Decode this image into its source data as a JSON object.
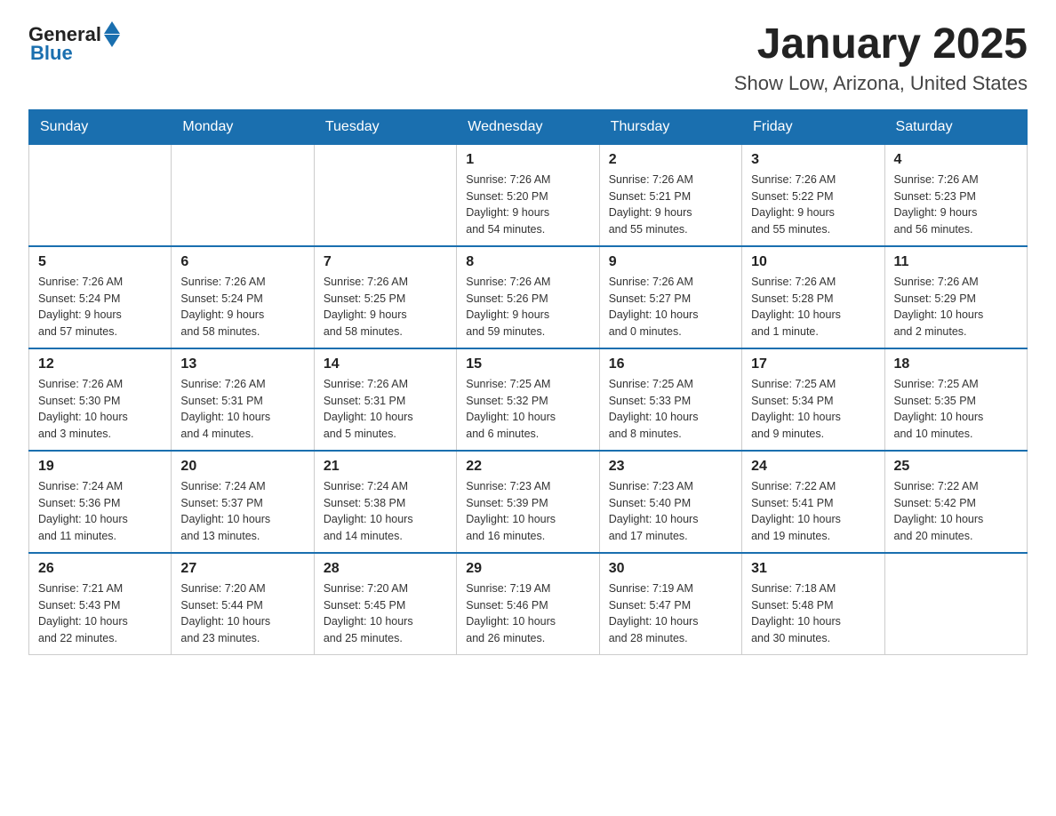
{
  "header": {
    "logo_general": "General",
    "logo_blue": "Blue",
    "month_title": "January 2025",
    "location": "Show Low, Arizona, United States"
  },
  "days_of_week": [
    "Sunday",
    "Monday",
    "Tuesday",
    "Wednesday",
    "Thursday",
    "Friday",
    "Saturday"
  ],
  "weeks": [
    [
      {
        "day": "",
        "info": ""
      },
      {
        "day": "",
        "info": ""
      },
      {
        "day": "",
        "info": ""
      },
      {
        "day": "1",
        "info": "Sunrise: 7:26 AM\nSunset: 5:20 PM\nDaylight: 9 hours\nand 54 minutes."
      },
      {
        "day": "2",
        "info": "Sunrise: 7:26 AM\nSunset: 5:21 PM\nDaylight: 9 hours\nand 55 minutes."
      },
      {
        "day": "3",
        "info": "Sunrise: 7:26 AM\nSunset: 5:22 PM\nDaylight: 9 hours\nand 55 minutes."
      },
      {
        "day": "4",
        "info": "Sunrise: 7:26 AM\nSunset: 5:23 PM\nDaylight: 9 hours\nand 56 minutes."
      }
    ],
    [
      {
        "day": "5",
        "info": "Sunrise: 7:26 AM\nSunset: 5:24 PM\nDaylight: 9 hours\nand 57 minutes."
      },
      {
        "day": "6",
        "info": "Sunrise: 7:26 AM\nSunset: 5:24 PM\nDaylight: 9 hours\nand 58 minutes."
      },
      {
        "day": "7",
        "info": "Sunrise: 7:26 AM\nSunset: 5:25 PM\nDaylight: 9 hours\nand 58 minutes."
      },
      {
        "day": "8",
        "info": "Sunrise: 7:26 AM\nSunset: 5:26 PM\nDaylight: 9 hours\nand 59 minutes."
      },
      {
        "day": "9",
        "info": "Sunrise: 7:26 AM\nSunset: 5:27 PM\nDaylight: 10 hours\nand 0 minutes."
      },
      {
        "day": "10",
        "info": "Sunrise: 7:26 AM\nSunset: 5:28 PM\nDaylight: 10 hours\nand 1 minute."
      },
      {
        "day": "11",
        "info": "Sunrise: 7:26 AM\nSunset: 5:29 PM\nDaylight: 10 hours\nand 2 minutes."
      }
    ],
    [
      {
        "day": "12",
        "info": "Sunrise: 7:26 AM\nSunset: 5:30 PM\nDaylight: 10 hours\nand 3 minutes."
      },
      {
        "day": "13",
        "info": "Sunrise: 7:26 AM\nSunset: 5:31 PM\nDaylight: 10 hours\nand 4 minutes."
      },
      {
        "day": "14",
        "info": "Sunrise: 7:26 AM\nSunset: 5:31 PM\nDaylight: 10 hours\nand 5 minutes."
      },
      {
        "day": "15",
        "info": "Sunrise: 7:25 AM\nSunset: 5:32 PM\nDaylight: 10 hours\nand 6 minutes."
      },
      {
        "day": "16",
        "info": "Sunrise: 7:25 AM\nSunset: 5:33 PM\nDaylight: 10 hours\nand 8 minutes."
      },
      {
        "day": "17",
        "info": "Sunrise: 7:25 AM\nSunset: 5:34 PM\nDaylight: 10 hours\nand 9 minutes."
      },
      {
        "day": "18",
        "info": "Sunrise: 7:25 AM\nSunset: 5:35 PM\nDaylight: 10 hours\nand 10 minutes."
      }
    ],
    [
      {
        "day": "19",
        "info": "Sunrise: 7:24 AM\nSunset: 5:36 PM\nDaylight: 10 hours\nand 11 minutes."
      },
      {
        "day": "20",
        "info": "Sunrise: 7:24 AM\nSunset: 5:37 PM\nDaylight: 10 hours\nand 13 minutes."
      },
      {
        "day": "21",
        "info": "Sunrise: 7:24 AM\nSunset: 5:38 PM\nDaylight: 10 hours\nand 14 minutes."
      },
      {
        "day": "22",
        "info": "Sunrise: 7:23 AM\nSunset: 5:39 PM\nDaylight: 10 hours\nand 16 minutes."
      },
      {
        "day": "23",
        "info": "Sunrise: 7:23 AM\nSunset: 5:40 PM\nDaylight: 10 hours\nand 17 minutes."
      },
      {
        "day": "24",
        "info": "Sunrise: 7:22 AM\nSunset: 5:41 PM\nDaylight: 10 hours\nand 19 minutes."
      },
      {
        "day": "25",
        "info": "Sunrise: 7:22 AM\nSunset: 5:42 PM\nDaylight: 10 hours\nand 20 minutes."
      }
    ],
    [
      {
        "day": "26",
        "info": "Sunrise: 7:21 AM\nSunset: 5:43 PM\nDaylight: 10 hours\nand 22 minutes."
      },
      {
        "day": "27",
        "info": "Sunrise: 7:20 AM\nSunset: 5:44 PM\nDaylight: 10 hours\nand 23 minutes."
      },
      {
        "day": "28",
        "info": "Sunrise: 7:20 AM\nSunset: 5:45 PM\nDaylight: 10 hours\nand 25 minutes."
      },
      {
        "day": "29",
        "info": "Sunrise: 7:19 AM\nSunset: 5:46 PM\nDaylight: 10 hours\nand 26 minutes."
      },
      {
        "day": "30",
        "info": "Sunrise: 7:19 AM\nSunset: 5:47 PM\nDaylight: 10 hours\nand 28 minutes."
      },
      {
        "day": "31",
        "info": "Sunrise: 7:18 AM\nSunset: 5:48 PM\nDaylight: 10 hours\nand 30 minutes."
      },
      {
        "day": "",
        "info": ""
      }
    ]
  ]
}
